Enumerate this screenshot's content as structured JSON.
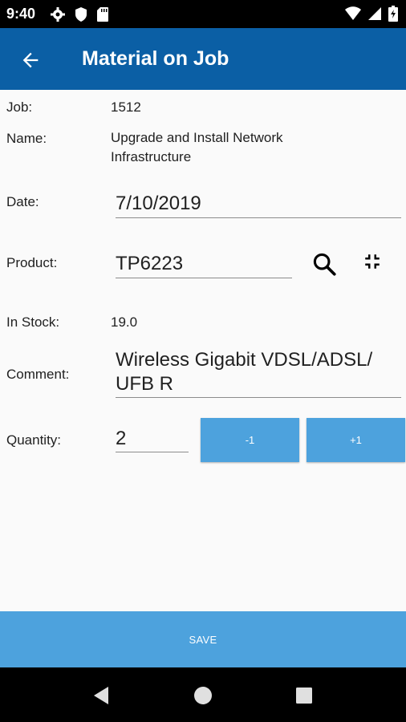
{
  "status_bar": {
    "time": "9:40",
    "left_icons": [
      "gear-icon",
      "shield-icon",
      "sd-card-icon"
    ],
    "right_icons": [
      "wifi-icon",
      "signal-icon",
      "battery-icon"
    ]
  },
  "app_bar": {
    "title": "Material on Job",
    "back_icon": "arrow-left-icon",
    "color": "#0b5fa5"
  },
  "form": {
    "job_label": "Job:",
    "job_value": "1512",
    "name_label": "Name:",
    "name_value_line1": "Upgrade and Install Network",
    "name_value_line2": "Infrastructure",
    "date_label": "Date:",
    "date_value": "7/10/2019",
    "product_label": "Product:",
    "product_value": "TP6223",
    "search_icon": "search-icon",
    "scan_icon": "collapse-icon",
    "in_stock_label": "In Stock:",
    "in_stock_value": "19.0",
    "comment_label": "Comment:",
    "comment_line1": "Wireless Gigabit VDSL/ADSL/",
    "comment_line2": "UFB R",
    "quantity_label": "Quantity:",
    "quantity_value": "2",
    "decrement_label": "-1",
    "increment_label": "+1"
  },
  "save_label": "SAVE",
  "accent_color": "#4da2dd",
  "nav_bar": {
    "icons": [
      "back-triangle-icon",
      "home-circle-icon",
      "recents-square-icon"
    ]
  }
}
